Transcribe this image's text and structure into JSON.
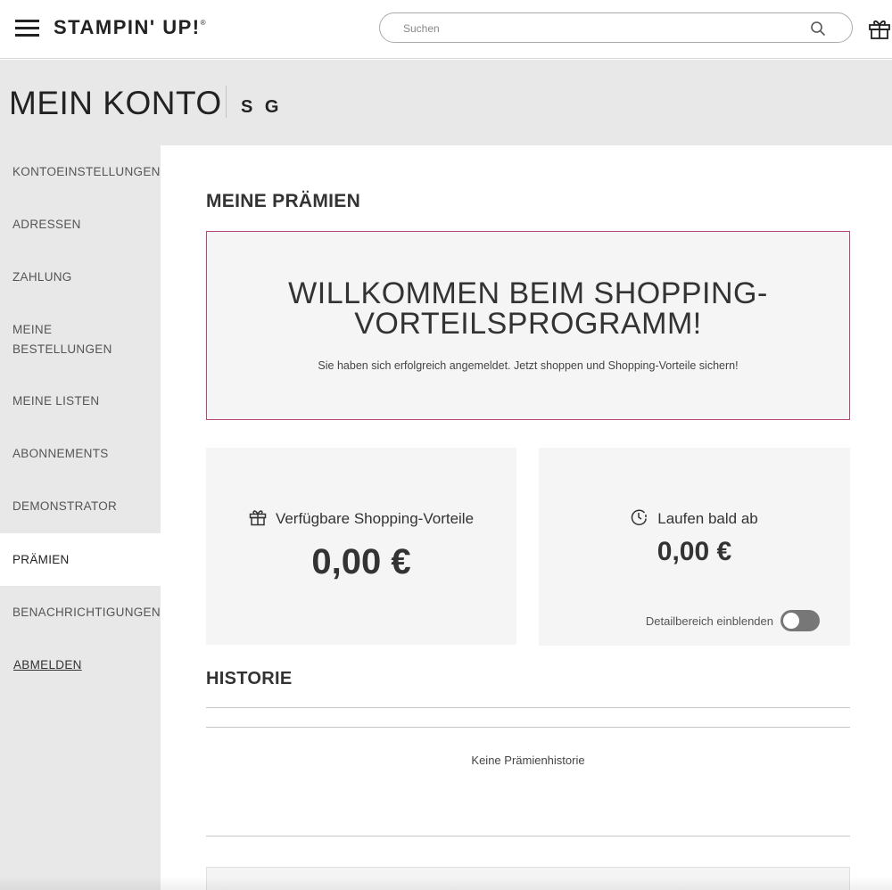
{
  "header": {
    "logo_text": "STAMPIN' UP!",
    "logo_mark": "®",
    "search_placeholder": "Suchen",
    "icons": {
      "menu": "hamburger-icon",
      "search": "search-icon",
      "gift": "gift-icon"
    }
  },
  "page": {
    "title": "MEIN KONTO",
    "user_initials": "S G"
  },
  "sidebar": {
    "items": [
      {
        "label": "KONTOEINSTELLUNGEN",
        "active": false
      },
      {
        "label": "ADRESSEN",
        "active": false
      },
      {
        "label": "ZAHLUNG",
        "active": false
      },
      {
        "label": "MEINE BESTELLUNGEN",
        "active": false
      },
      {
        "label": "MEINE LISTEN",
        "active": false
      },
      {
        "label": "ABONNEMENTS",
        "active": false
      },
      {
        "label": "DEMONSTRATOR",
        "active": false
      },
      {
        "label": "PRÄMIEN",
        "active": true
      },
      {
        "label": "BENACHRICHTIGUNGEN",
        "active": false
      }
    ],
    "logout_label": "ABMELDEN"
  },
  "main": {
    "section_title": "MEINE PRÄMIEN",
    "welcome": {
      "title_line1": "WILLKOMMEN BEIM SHOPPING-",
      "title_line2": "VORTEILSPROGRAMM!",
      "subtitle": "Sie haben sich erfolgreich angemeldet. Jetzt shoppen und Shopping-Vorteile sichern!"
    },
    "available": {
      "label": "Verfügbare Shopping-Vorteile",
      "value": "0,00 €",
      "icon": "gift-icon"
    },
    "expiring": {
      "label": "Laufen bald ab",
      "value": "0,00 €",
      "icon": "clock-alert-icon",
      "toggle_label": "Detailbereich einblenden",
      "toggle_on": false
    },
    "history": {
      "title": "HISTORIE",
      "empty_text": "Keine Prämienhistorie"
    }
  },
  "colors": {
    "accent_border": "#b5467a",
    "panel_bg": "#f5f5f5",
    "sidebar_bg": "#e8e8e8",
    "toggle_off": "#777777"
  }
}
